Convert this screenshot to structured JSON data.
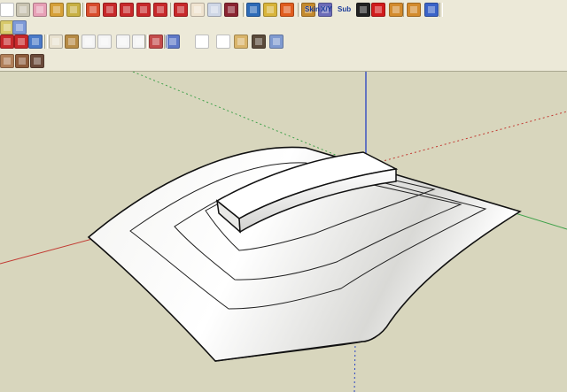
{
  "toolbar": {
    "row1": [
      {
        "name": "select-tool-button",
        "icon": "arrow-icon",
        "color": "#ffffff"
      },
      {
        "name": "make-component-button",
        "icon": "component-icon",
        "color": "#c9c4b2"
      },
      {
        "name": "eraser-button",
        "icon": "eraser-icon",
        "color": "#e7a0b6"
      },
      {
        "name": "paint-bucket-button",
        "icon": "paint-bucket-icon",
        "color": "#d6a038"
      },
      {
        "name": "measure-button",
        "icon": "tape-measure-icon",
        "color": "#c8b043"
      },
      {
        "name": "push-pull-button",
        "icon": "push-pull-icon",
        "color": "#d94c2b"
      },
      {
        "name": "move-button",
        "icon": "move-icon",
        "color": "#c7282a"
      },
      {
        "name": "rotate-button",
        "icon": "rotate-icon",
        "color": "#c7282a"
      },
      {
        "name": "follow-me-button",
        "icon": "follow-me-icon",
        "color": "#c7282a"
      },
      {
        "name": "scale-button",
        "icon": "scale-icon",
        "color": "#c7282a"
      },
      {
        "name": "orbit-button",
        "icon": "orbit-icon",
        "color": "#c7282a"
      },
      {
        "name": "pan-button",
        "icon": "hand-icon",
        "color": "#f0e4d0"
      },
      {
        "name": "zoom-button",
        "icon": "magnifier-icon",
        "color": "#cfd7e6"
      },
      {
        "name": "zoom-extents-button",
        "icon": "zoom-extents-icon",
        "color": "#8a2430"
      },
      {
        "name": "geolocation-button",
        "icon": "globe-icon",
        "color": "#2d6bb7"
      },
      {
        "name": "get-models-button",
        "icon": "warehouse-icon",
        "color": "#d8b43a"
      },
      {
        "name": "share-model-button",
        "icon": "share-icon",
        "color": "#e05d1e"
      },
      {
        "name": "components-button",
        "icon": "box-icon",
        "color": "#c48a2e"
      },
      {
        "name": "materials-button",
        "icon": "materials-icon",
        "color": "#6c6cb8"
      },
      {
        "name": "plugin-skin-button",
        "icon": "skin-icon",
        "color": "#1a3b9a"
      },
      {
        "name": "plugin-xyz-button",
        "icon": "xyz-icon",
        "color": "#1a3b9a"
      },
      {
        "name": "plugin-sub-button",
        "icon": "sub-icon",
        "color": "#1a3b9a"
      },
      {
        "name": "play-button",
        "icon": "play-icon",
        "color": "#222222"
      },
      {
        "name": "stop-button",
        "icon": "stop-icon",
        "color": "#d11b1b"
      },
      {
        "name": "sandbox-from-contours-button",
        "icon": "sandbox-icon",
        "color": "#d38b2d"
      },
      {
        "name": "sandbox-stamp-button",
        "icon": "stamp-icon",
        "color": "#d38b2d"
      },
      {
        "name": "sandbox-drape-button",
        "icon": "drape-icon",
        "color": "#3a63c8"
      }
    ],
    "row1_text": {
      "skin": "Skin",
      "xyz": "X/Y",
      "sub": "Sub"
    },
    "row2": [
      {
        "name": "line-tool-button",
        "icon": "pencil-icon",
        "color": "#d8c96a"
      },
      {
        "name": "rectangle-tool-button",
        "icon": "rectangle-icon",
        "color": "#7e9ad8"
      },
      {
        "name": "front-view-button",
        "icon": "house-front-icon",
        "color": "#e9e2d0"
      },
      {
        "name": "iso-view-button",
        "icon": "house-iso-icon",
        "color": "#b78b45"
      },
      {
        "name": "back-view-button",
        "icon": "house-back-icon",
        "color": "#f5f5f5"
      },
      {
        "name": "right-view-button",
        "icon": "house-right-icon",
        "color": "#f5f5f5"
      },
      {
        "name": "left-view-button",
        "icon": "house-left-icon",
        "color": "#f5f5f5"
      },
      {
        "name": "top-view-button",
        "icon": "house-top-icon",
        "color": "#f5f5f5"
      },
      {
        "name": "section-plane-button",
        "icon": "section-icon",
        "color": "#c34b4b"
      },
      {
        "name": "xray-style-button",
        "icon": "xray-cube-icon",
        "color": "#5f78c7"
      },
      {
        "name": "wireframe-style-button",
        "icon": "wireframe-cube-icon",
        "color": "#ffffff"
      },
      {
        "name": "hidden-line-style-button",
        "icon": "hidden-line-cube-icon",
        "color": "#ffffff"
      },
      {
        "name": "shaded-style-button",
        "icon": "shaded-cube-icon",
        "color": "#d9b46a"
      },
      {
        "name": "textured-style-button",
        "icon": "textured-cube-icon",
        "color": "#5a4a3a"
      },
      {
        "name": "monochrome-style-button",
        "icon": "monochrome-cube-icon",
        "color": "#7f9ad0"
      }
    ],
    "row3": [
      {
        "name": "texture-brick-button",
        "icon": "brick-texture-icon",
        "color": "#b07f58"
      },
      {
        "name": "texture-wood-button",
        "icon": "wood-texture-icon",
        "color": "#8c5a3a"
      },
      {
        "name": "texture-stone-button",
        "icon": "stone-texture-icon",
        "color": "#6a4a3a"
      }
    ]
  },
  "scene": {
    "axes": {
      "red": "#c23a32",
      "green": "#3fa14a",
      "blue": "#2741c4"
    },
    "shapes": [
      "curved-terrain-surface",
      "contour-rings",
      "raised-curved-block"
    ]
  }
}
